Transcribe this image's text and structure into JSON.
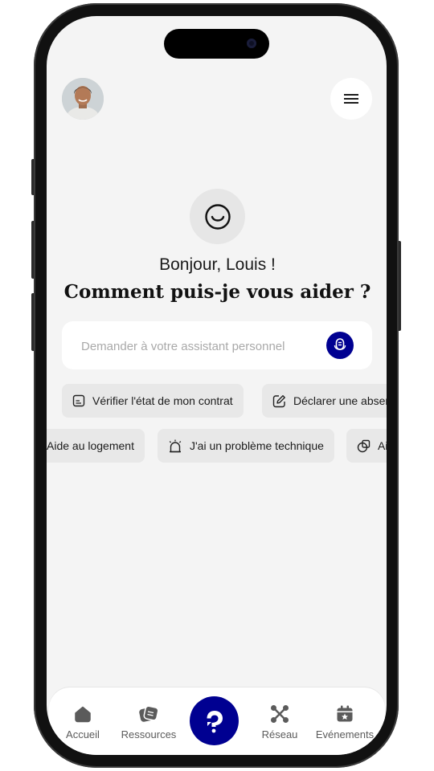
{
  "header": {
    "avatar_alt": "Photo de profil",
    "menu_icon": "hamburger-menu-icon"
  },
  "hero": {
    "icon": "smiley-icon",
    "greeting": "Bonjour, Louis !",
    "question": "Comment puis-je vous aider ?"
  },
  "search": {
    "placeholder": "Demander à votre assistant personnel",
    "mic_icon": "microphone-icon"
  },
  "suggestions_row1": [
    {
      "label": "Vérifier l'état de mon contrat",
      "icon": "document-icon"
    },
    {
      "label": "Déclarer une absence",
      "icon": "edit-icon"
    }
  ],
  "suggestions_row2": [
    {
      "label": "Aide au logement",
      "icon": "home-icon"
    },
    {
      "label": "J'ai un problème technique",
      "icon": "alarm-icon"
    },
    {
      "label": "Ai",
      "icon": "shape-icon"
    }
  ],
  "bottom_nav": {
    "items": [
      {
        "label": "Accueil",
        "icon": "home-icon"
      },
      {
        "label": "Ressources",
        "icon": "resources-icon"
      },
      {
        "label": "",
        "icon": "assistant-icon"
      },
      {
        "label": "Réseau",
        "icon": "network-icon"
      },
      {
        "label": "Evénements",
        "icon": "calendar-icon"
      }
    ]
  },
  "colors": {
    "accent": "#000091",
    "background": "#f4f4f4",
    "chip": "#e8e8e8"
  }
}
